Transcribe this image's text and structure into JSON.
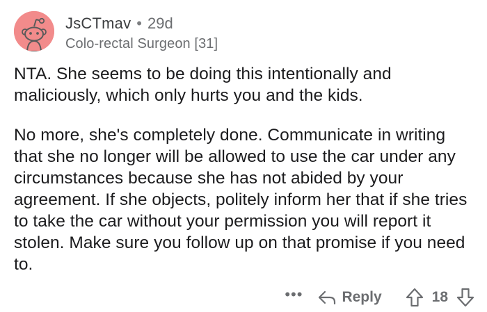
{
  "comment": {
    "author": "JsCTmav",
    "separator": "•",
    "age": "29d",
    "flair": "Colo-rectal Surgeon [31]",
    "avatar_icon": "snoo-avatar-icon",
    "avatar_bg": "#f28b8b",
    "paragraphs": [
      "NTA. She seems to be doing this intentionally and maliciously, which only hurts you and the kids.",
      "No more, she's completely done. Communicate in writing that she no longer will be allowed to use the car under any circumstances because she has not abided by your agreement. If she objects, politely inform her that if she tries to take the car without your permission you will report it stolen. Make sure you follow up on that promise if you need to."
    ]
  },
  "actions": {
    "more_label": "•••",
    "reply_label": "Reply",
    "reply_icon": "reply-arrow-icon",
    "upvote_icon": "upvote-arrow-icon",
    "downvote_icon": "downvote-arrow-icon",
    "score": "18"
  },
  "colors": {
    "text": "#1c1c1e",
    "meta": "#6b6d70",
    "background": "#ffffff"
  }
}
